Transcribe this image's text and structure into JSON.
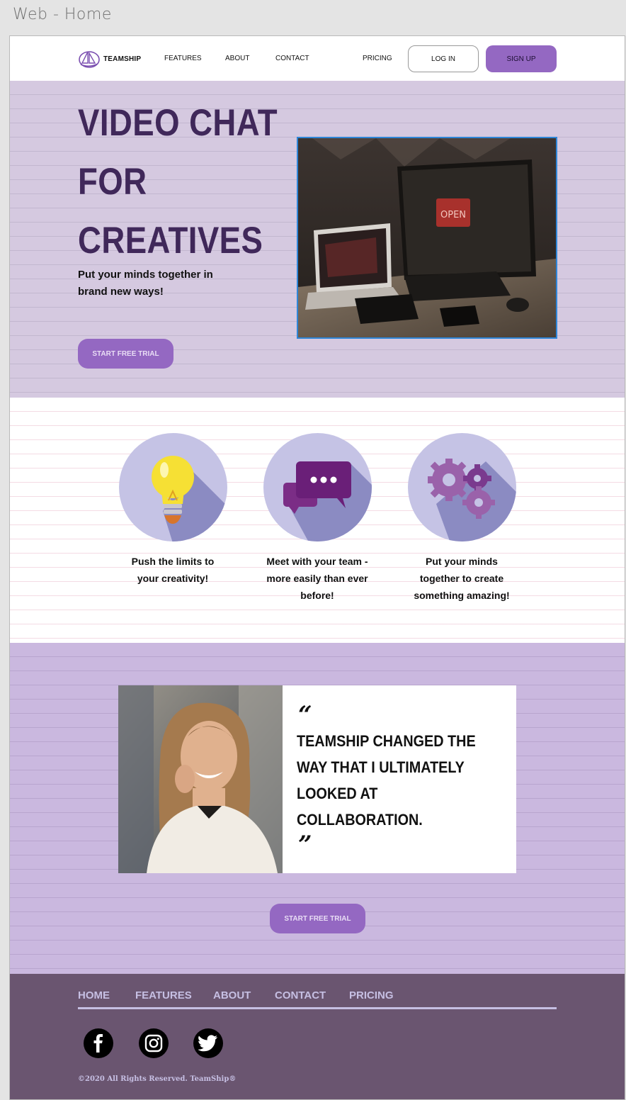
{
  "canvas": {
    "title": "Web - Home"
  },
  "nav": {
    "brand": "TEAMSHIP",
    "links": [
      "FEATURES",
      "ABOUT",
      "CONTACT",
      "PRICING"
    ],
    "login_label": "LOG IN",
    "signup_label": "SIGN UP"
  },
  "hero": {
    "title_lines": [
      "VIDEO CHAT",
      "FOR",
      "CREATIVES"
    ],
    "subtitle": "Put your minds together in brand new ways!",
    "cta_label": "START FREE TRIAL"
  },
  "features": [
    {
      "icon": "lightbulb-icon",
      "text": "Push the limits to your creativity!"
    },
    {
      "icon": "chat-bubbles-icon",
      "text": "Meet with your team - more easily than ever before!"
    },
    {
      "icon": "gears-icon",
      "text": "Put your minds together to create something amazing!"
    }
  ],
  "testimonial": {
    "open_quote": "“",
    "close_quote": "”",
    "text": "TEAMSHIP CHANGED THE WAY THAT I ULTIMATELY LOOKED AT COLLABORATION.",
    "cta_label": "START FREE TRIAL"
  },
  "footer": {
    "links": [
      "HOME",
      "FEATURES",
      "ABOUT",
      "CONTACT",
      "PRICING"
    ],
    "social": [
      "facebook-icon",
      "instagram-icon",
      "twitter-icon"
    ],
    "copyright": "©2020 All Rights Reserved. TeamShip®"
  },
  "colors": {
    "accent": "#9468c2",
    "hero_bg": "#d5c9e0",
    "hero_title": "#40285a",
    "testimonial_bg": "#cab8df",
    "footer_bg": "#6a5570",
    "footer_text": "#c6bfe3"
  }
}
